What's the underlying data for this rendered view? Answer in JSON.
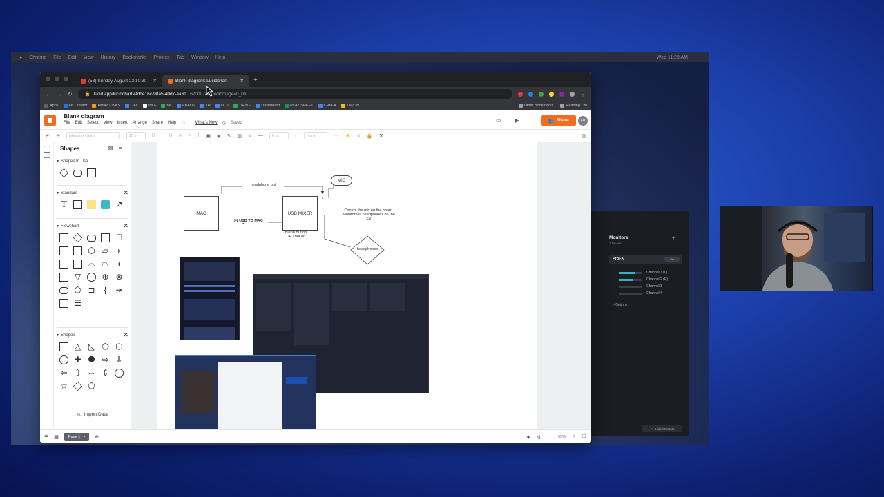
{
  "menubar": {
    "items": [
      "Chrome",
      "File",
      "Edit",
      "View",
      "History",
      "Bookmarks",
      "Profiles",
      "Tab",
      "Window",
      "Help"
    ],
    "clock": "Wed 11:29 AM"
  },
  "browser": {
    "tabs": [
      {
        "label": "(58) Sunday August 22 10:30",
        "favicon_color": "#e53935",
        "active": false
      },
      {
        "label": "Blank diagram: Lucidchart",
        "favicon_color": "#f26c21",
        "active": true
      }
    ],
    "url_main": "lucid.app/lucidchart/4fdbe16c-98a5-40d7-aa6d",
    "url_rest": "...670d07401/edit?page=0_0#",
    "bookmarks": [
      "Apps",
      "FB Creator",
      "AMAZ LINKS",
      "CAL",
      "WLF",
      "ML",
      "FBADS",
      "TR",
      "DCS",
      "DRIVE",
      "Dashboard",
      "PLAY SHEET",
      "CRM-A",
      "TAPUN"
    ],
    "bookmarks_right": [
      "Other Bookmarks",
      "Reading List"
    ]
  },
  "lucid": {
    "doc_title": "Blank diagram",
    "menu": [
      "File",
      "Edit",
      "Select",
      "View",
      "Insert",
      "Arrange",
      "Share",
      "Help"
    ],
    "whats_new": "What's New",
    "saved": "Saved",
    "share_label": "Share",
    "avatar_initials": "ER",
    "toolbar": {
      "font": "Liberation Sans",
      "font_size": "10 pt",
      "line_width": "0 px",
      "line_end": "None"
    },
    "shapes_panel": {
      "title": "Shapes",
      "sections": [
        "Shapes In Use",
        "Standard",
        "Flowchart",
        "Shapes"
      ],
      "import_label": "Import Data"
    },
    "diagram": {
      "mac": "MAC",
      "usb_mixer": "USB MIXER",
      "mic": "MIC",
      "headphones": "headphones",
      "headphone_out": "headphone out",
      "in_usb_to_mac": "IN USB TO MAC",
      "blend_button": "Blend Button\nUP / not on",
      "control_note": "Control the mix on the board.\nMonitor via headphones on the FX"
    },
    "page_tab": "Page 1",
    "zoom": "59%"
  },
  "monitors_panel": {
    "title": "Monitors",
    "subtitle": "1 Device",
    "device": "ProFX",
    "toggle": "On",
    "channels": [
      {
        "label": "Channel 1 (L)",
        "level": 0.7
      },
      {
        "label": "Channel 2 (R)",
        "level": 0.6
      },
      {
        "label": "Channel 3",
        "level": 0
      },
      {
        "label": "Channel 4",
        "level": 0
      }
    ],
    "options": "Options",
    "hide_label": "Hide Monitors"
  }
}
